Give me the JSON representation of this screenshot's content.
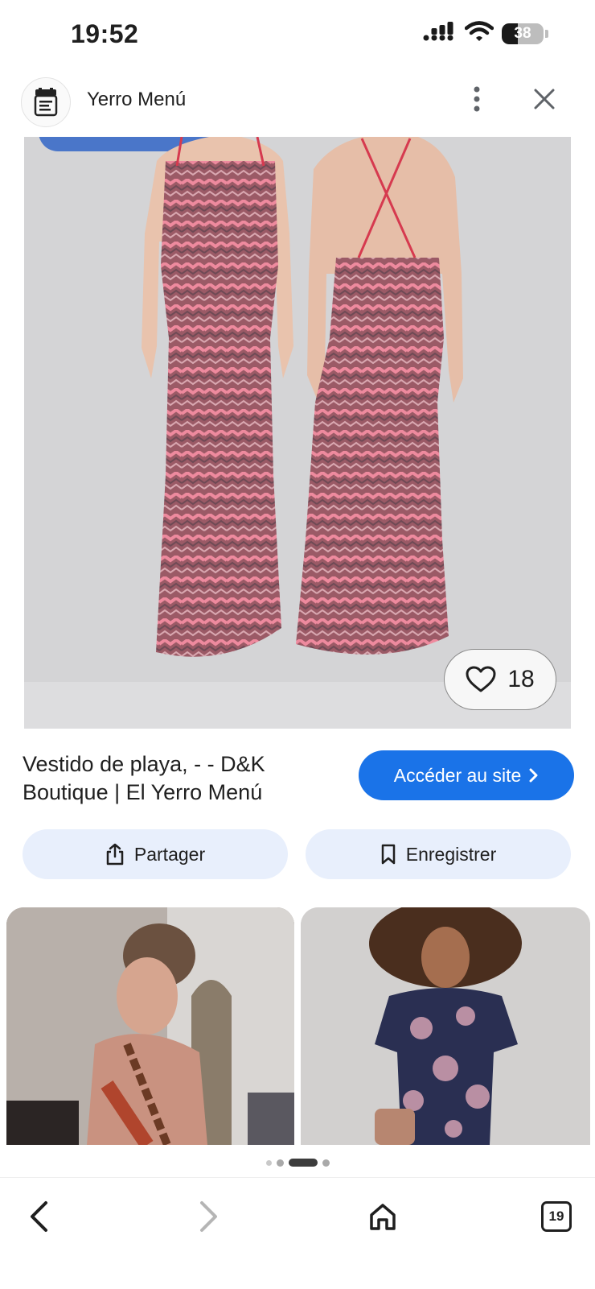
{
  "status_bar": {
    "time": "19:52",
    "battery": "38",
    "battery_level_percent": 38,
    "icons": [
      "signal-icon",
      "wifi-icon",
      "battery-icon"
    ]
  },
  "header": {
    "site_name": "Yerro Menú",
    "icons": [
      "site-logo-icon",
      "more-vert-icon",
      "close-icon"
    ]
  },
  "main_image": {
    "like_count": "18",
    "icons": [
      "heart-icon"
    ]
  },
  "result": {
    "title": "Vestido de playa, - - D&K Boutique | El Yerro Menú",
    "visit_label": "Accéder au site",
    "share_label": "Partager",
    "save_label": "Enregistrer",
    "icons": [
      "chevron-right-icon",
      "share-icon",
      "bookmark-icon"
    ]
  },
  "pagination": {
    "dot_count": 4,
    "active_index": 2
  },
  "bottom_nav": {
    "tabs_count": "19",
    "icons": [
      "back-icon",
      "forward-icon",
      "home-icon",
      "tabs-icon"
    ]
  },
  "colors": {
    "accent": "#1a73e8",
    "chip_bg": "#e8effc",
    "image_bg": "#d4d4d6",
    "dress_pink": "#cc5a72"
  }
}
